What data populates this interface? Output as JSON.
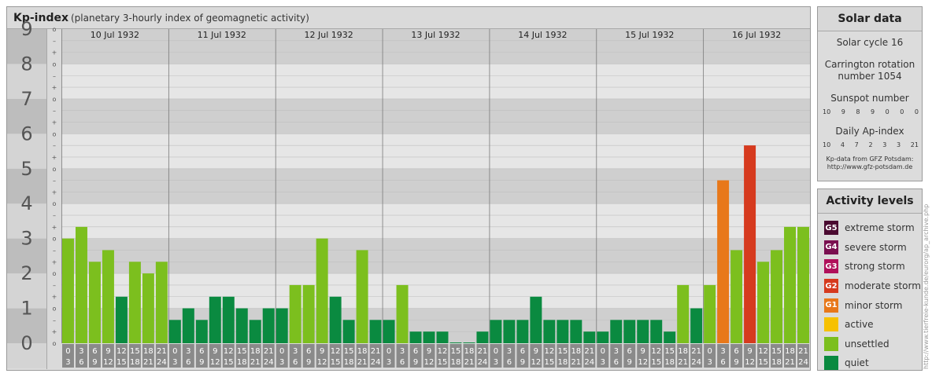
{
  "chart_data": {
    "type": "bar",
    "title": "Kp-index",
    "subtitle": "(planetary 3-hourly index of geomagnetic activity)",
    "ylim": [
      0,
      9
    ],
    "y_ticks": [
      "0",
      "1",
      "2",
      "3",
      "4",
      "5",
      "6",
      "7",
      "8",
      "9"
    ],
    "y_minor_ticks": [
      "o",
      "+",
      "–",
      "o",
      "+",
      "–",
      "o",
      "+",
      "–",
      "o",
      "+",
      "–",
      "o",
      "+",
      "–",
      "o",
      "+",
      "–",
      "o",
      "+",
      "–",
      "o",
      "+",
      "–",
      "o",
      "+",
      "–",
      "o"
    ],
    "days": [
      "10 Jul 1932",
      "11 Jul 1932",
      "12 Jul 1932",
      "13 Jul 1932",
      "14 Jul 1932",
      "15 Jul 1932",
      "16 Jul 1932"
    ],
    "interval_starts": [
      "0",
      "3",
      "6",
      "9",
      "12",
      "15",
      "18",
      "21"
    ],
    "interval_ends": [
      "3",
      "6",
      "9",
      "12",
      "15",
      "18",
      "21",
      "24"
    ],
    "values": [
      3.0,
      3.333,
      2.333,
      2.667,
      1.333,
      2.333,
      2.0,
      2.333,
      0.667,
      1.0,
      0.667,
      1.333,
      1.333,
      1.0,
      0.667,
      1.0,
      1.0,
      1.667,
      1.667,
      3.0,
      1.333,
      0.667,
      2.667,
      0.667,
      0.667,
      1.667,
      0.333,
      0.333,
      0.333,
      0.0,
      0.0,
      0.333,
      0.667,
      0.667,
      0.667,
      1.333,
      0.667,
      0.667,
      0.667,
      0.333,
      0.333,
      0.667,
      0.667,
      0.667,
      0.667,
      0.333,
      1.667,
      1.0,
      1.667,
      4.667,
      2.667,
      5.667,
      2.333,
      2.667,
      3.333,
      3.333
    ],
    "value_levels": [
      "unsettled",
      "unsettled",
      "unsettled",
      "unsettled",
      "quiet",
      "unsettled",
      "unsettled",
      "unsettled",
      "quiet",
      "quiet",
      "quiet",
      "quiet",
      "quiet",
      "quiet",
      "quiet",
      "quiet",
      "quiet",
      "unsettled",
      "unsettled",
      "unsettled",
      "quiet",
      "quiet",
      "unsettled",
      "quiet",
      "quiet",
      "unsettled",
      "quiet",
      "quiet",
      "quiet",
      "quiet",
      "quiet",
      "quiet",
      "quiet",
      "quiet",
      "quiet",
      "quiet",
      "quiet",
      "quiet",
      "quiet",
      "quiet",
      "quiet",
      "quiet",
      "quiet",
      "quiet",
      "quiet",
      "quiet",
      "unsettled",
      "quiet",
      "unsettled",
      "minor",
      "unsettled",
      "moderate",
      "unsettled",
      "unsettled",
      "unsettled",
      "unsettled"
    ]
  },
  "solar": {
    "title": "Solar data",
    "cycle": "Solar cycle 16",
    "carrington_line1": "Carrington rotation",
    "carrington_line2": "number 1054",
    "sunspot_title": "Sunspot number",
    "sunspot_values": [
      "10",
      "9",
      "8",
      "9",
      "0",
      "0",
      "0"
    ],
    "ap_title": "Daily Ap-index",
    "ap_values": [
      "10",
      "4",
      "7",
      "2",
      "3",
      "3",
      "21"
    ],
    "credit_line1": "Kp-data from GFZ Potsdam:",
    "credit_line2": "http://www.gfz-potsdam.de"
  },
  "activity": {
    "title": "Activity levels",
    "items": [
      {
        "code": "G5",
        "label": "extreme storm",
        "color": "#4a0a30"
      },
      {
        "code": "G4",
        "label": "severe storm",
        "color": "#7a1050"
      },
      {
        "code": "G3",
        "label": "strong storm",
        "color": "#b0105a"
      },
      {
        "code": "G2",
        "label": "moderate storm",
        "color": "#d63a1e"
      },
      {
        "code": "G1",
        "label": "minor storm",
        "color": "#e8781a"
      },
      {
        "code": "",
        "label": "active",
        "color": "#f6c100"
      },
      {
        "code": "",
        "label": "unsettled",
        "color": "#7cbf1e"
      },
      {
        "code": "",
        "label": "quiet",
        "color": "#0a8a40"
      }
    ]
  },
  "colors": {
    "quiet": "#0a8a40",
    "unsettled": "#7cbf1e",
    "active": "#f6c100",
    "minor": "#e8781a",
    "moderate": "#d63a1e"
  },
  "watermark": "http://www.tierfreie-kunde.de/eurorg/ap_archive.php"
}
